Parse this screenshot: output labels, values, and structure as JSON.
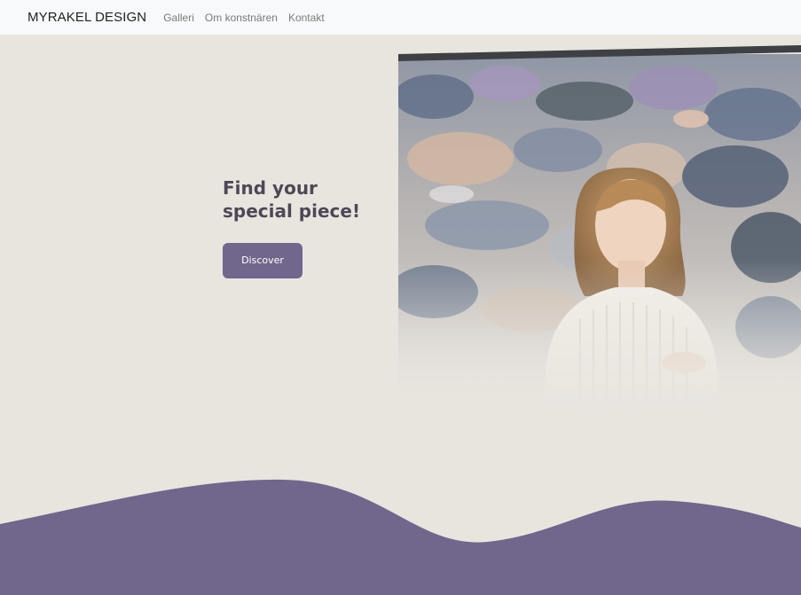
{
  "nav": {
    "brand": "MYRAKEL DESIGN",
    "links": [
      {
        "label": "Galleri"
      },
      {
        "label": "Om konstnären"
      },
      {
        "label": "Kontakt"
      }
    ]
  },
  "hero": {
    "headline_line1": "Find your",
    "headline_line2": "special piece!",
    "cta_label": "Discover"
  },
  "colors": {
    "background": "#e8e5df",
    "accent": "#71668b",
    "headline": "#4e4756",
    "navbar": "#f8f9fa"
  }
}
